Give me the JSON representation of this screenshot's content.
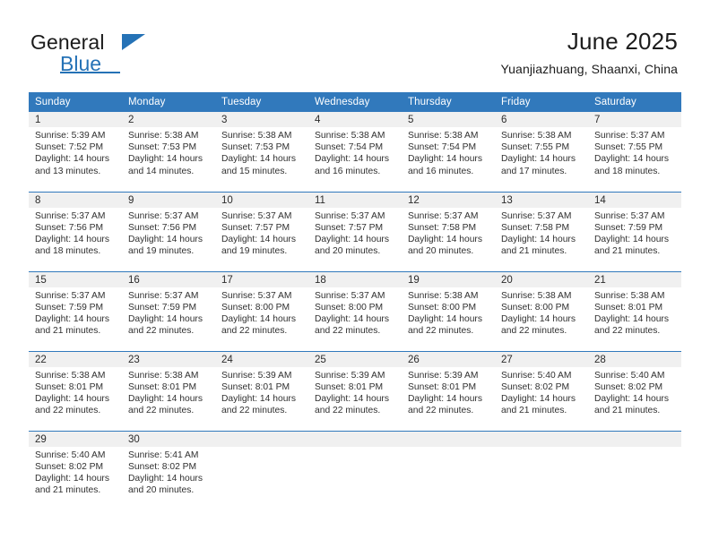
{
  "brand": {
    "name_top": "General",
    "name_bottom": "Blue",
    "accent_color": "#2572b6"
  },
  "header": {
    "title": "June 2025",
    "location": "Yuanjiazhuang, Shaanxi, China"
  },
  "theme": {
    "header_row_bg": "#3179bc",
    "daynum_band_bg": "#f0f0f0",
    "row_separator": "#3179bc",
    "text_color": "#303030"
  },
  "weekday_headers": [
    "Sunday",
    "Monday",
    "Tuesday",
    "Wednesday",
    "Thursday",
    "Friday",
    "Saturday"
  ],
  "labels": {
    "sunrise_prefix": "Sunrise:",
    "sunset_prefix": "Sunset:",
    "daylight_prefix": "Daylight:"
  },
  "weeks": [
    [
      {
        "day": "1",
        "sunrise": "Sunrise: 5:39 AM",
        "sunset": "Sunset: 7:52 PM",
        "daylight_line1": "Daylight: 14 hours",
        "daylight_line2": "and 13 minutes."
      },
      {
        "day": "2",
        "sunrise": "Sunrise: 5:38 AM",
        "sunset": "Sunset: 7:53 PM",
        "daylight_line1": "Daylight: 14 hours",
        "daylight_line2": "and 14 minutes."
      },
      {
        "day": "3",
        "sunrise": "Sunrise: 5:38 AM",
        "sunset": "Sunset: 7:53 PM",
        "daylight_line1": "Daylight: 14 hours",
        "daylight_line2": "and 15 minutes."
      },
      {
        "day": "4",
        "sunrise": "Sunrise: 5:38 AM",
        "sunset": "Sunset: 7:54 PM",
        "daylight_line1": "Daylight: 14 hours",
        "daylight_line2": "and 16 minutes."
      },
      {
        "day": "5",
        "sunrise": "Sunrise: 5:38 AM",
        "sunset": "Sunset: 7:54 PM",
        "daylight_line1": "Daylight: 14 hours",
        "daylight_line2": "and 16 minutes."
      },
      {
        "day": "6",
        "sunrise": "Sunrise: 5:38 AM",
        "sunset": "Sunset: 7:55 PM",
        "daylight_line1": "Daylight: 14 hours",
        "daylight_line2": "and 17 minutes."
      },
      {
        "day": "7",
        "sunrise": "Sunrise: 5:37 AM",
        "sunset": "Sunset: 7:55 PM",
        "daylight_line1": "Daylight: 14 hours",
        "daylight_line2": "and 18 minutes."
      }
    ],
    [
      {
        "day": "8",
        "sunrise": "Sunrise: 5:37 AM",
        "sunset": "Sunset: 7:56 PM",
        "daylight_line1": "Daylight: 14 hours",
        "daylight_line2": "and 18 minutes."
      },
      {
        "day": "9",
        "sunrise": "Sunrise: 5:37 AM",
        "sunset": "Sunset: 7:56 PM",
        "daylight_line1": "Daylight: 14 hours",
        "daylight_line2": "and 19 minutes."
      },
      {
        "day": "10",
        "sunrise": "Sunrise: 5:37 AM",
        "sunset": "Sunset: 7:57 PM",
        "daylight_line1": "Daylight: 14 hours",
        "daylight_line2": "and 19 minutes."
      },
      {
        "day": "11",
        "sunrise": "Sunrise: 5:37 AM",
        "sunset": "Sunset: 7:57 PM",
        "daylight_line1": "Daylight: 14 hours",
        "daylight_line2": "and 20 minutes."
      },
      {
        "day": "12",
        "sunrise": "Sunrise: 5:37 AM",
        "sunset": "Sunset: 7:58 PM",
        "daylight_line1": "Daylight: 14 hours",
        "daylight_line2": "and 20 minutes."
      },
      {
        "day": "13",
        "sunrise": "Sunrise: 5:37 AM",
        "sunset": "Sunset: 7:58 PM",
        "daylight_line1": "Daylight: 14 hours",
        "daylight_line2": "and 21 minutes."
      },
      {
        "day": "14",
        "sunrise": "Sunrise: 5:37 AM",
        "sunset": "Sunset: 7:59 PM",
        "daylight_line1": "Daylight: 14 hours",
        "daylight_line2": "and 21 minutes."
      }
    ],
    [
      {
        "day": "15",
        "sunrise": "Sunrise: 5:37 AM",
        "sunset": "Sunset: 7:59 PM",
        "daylight_line1": "Daylight: 14 hours",
        "daylight_line2": "and 21 minutes."
      },
      {
        "day": "16",
        "sunrise": "Sunrise: 5:37 AM",
        "sunset": "Sunset: 7:59 PM",
        "daylight_line1": "Daylight: 14 hours",
        "daylight_line2": "and 22 minutes."
      },
      {
        "day": "17",
        "sunrise": "Sunrise: 5:37 AM",
        "sunset": "Sunset: 8:00 PM",
        "daylight_line1": "Daylight: 14 hours",
        "daylight_line2": "and 22 minutes."
      },
      {
        "day": "18",
        "sunrise": "Sunrise: 5:37 AM",
        "sunset": "Sunset: 8:00 PM",
        "daylight_line1": "Daylight: 14 hours",
        "daylight_line2": "and 22 minutes."
      },
      {
        "day": "19",
        "sunrise": "Sunrise: 5:38 AM",
        "sunset": "Sunset: 8:00 PM",
        "daylight_line1": "Daylight: 14 hours",
        "daylight_line2": "and 22 minutes."
      },
      {
        "day": "20",
        "sunrise": "Sunrise: 5:38 AM",
        "sunset": "Sunset: 8:00 PM",
        "daylight_line1": "Daylight: 14 hours",
        "daylight_line2": "and 22 minutes."
      },
      {
        "day": "21",
        "sunrise": "Sunrise: 5:38 AM",
        "sunset": "Sunset: 8:01 PM",
        "daylight_line1": "Daylight: 14 hours",
        "daylight_line2": "and 22 minutes."
      }
    ],
    [
      {
        "day": "22",
        "sunrise": "Sunrise: 5:38 AM",
        "sunset": "Sunset: 8:01 PM",
        "daylight_line1": "Daylight: 14 hours",
        "daylight_line2": "and 22 minutes."
      },
      {
        "day": "23",
        "sunrise": "Sunrise: 5:38 AM",
        "sunset": "Sunset: 8:01 PM",
        "daylight_line1": "Daylight: 14 hours",
        "daylight_line2": "and 22 minutes."
      },
      {
        "day": "24",
        "sunrise": "Sunrise: 5:39 AM",
        "sunset": "Sunset: 8:01 PM",
        "daylight_line1": "Daylight: 14 hours",
        "daylight_line2": "and 22 minutes."
      },
      {
        "day": "25",
        "sunrise": "Sunrise: 5:39 AM",
        "sunset": "Sunset: 8:01 PM",
        "daylight_line1": "Daylight: 14 hours",
        "daylight_line2": "and 22 minutes."
      },
      {
        "day": "26",
        "sunrise": "Sunrise: 5:39 AM",
        "sunset": "Sunset: 8:01 PM",
        "daylight_line1": "Daylight: 14 hours",
        "daylight_line2": "and 22 minutes."
      },
      {
        "day": "27",
        "sunrise": "Sunrise: 5:40 AM",
        "sunset": "Sunset: 8:02 PM",
        "daylight_line1": "Daylight: 14 hours",
        "daylight_line2": "and 21 minutes."
      },
      {
        "day": "28",
        "sunrise": "Sunrise: 5:40 AM",
        "sunset": "Sunset: 8:02 PM",
        "daylight_line1": "Daylight: 14 hours",
        "daylight_line2": "and 21 minutes."
      }
    ],
    [
      {
        "day": "29",
        "sunrise": "Sunrise: 5:40 AM",
        "sunset": "Sunset: 8:02 PM",
        "daylight_line1": "Daylight: 14 hours",
        "daylight_line2": "and 21 minutes."
      },
      {
        "day": "30",
        "sunrise": "Sunrise: 5:41 AM",
        "sunset": "Sunset: 8:02 PM",
        "daylight_line1": "Daylight: 14 hours",
        "daylight_line2": "and 20 minutes."
      },
      {
        "day": "",
        "empty": true
      },
      {
        "day": "",
        "empty": true
      },
      {
        "day": "",
        "empty": true
      },
      {
        "day": "",
        "empty": true
      },
      {
        "day": "",
        "empty": true
      }
    ]
  ]
}
